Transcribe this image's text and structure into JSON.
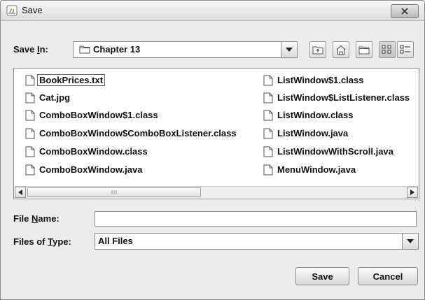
{
  "window": {
    "title": "Save"
  },
  "save_in": {
    "label_prefix": "Save ",
    "label_mnemonic": "I",
    "label_suffix": "n:",
    "selected": "Chapter 13"
  },
  "toolbar": {
    "buttons": [
      "up-one-level-icon",
      "home-icon",
      "new-folder-icon",
      "list-view-icon",
      "details-view-icon"
    ],
    "selected": "list-view-icon"
  },
  "files": {
    "column1": [
      "BookPrices.txt",
      "Cat.jpg",
      "ComboBoxWindow$1.class",
      "ComboBoxWindow$ComboBoxListener.class",
      "ComboBoxWindow.class",
      "ComboBoxWindow.java"
    ],
    "column2": [
      "ListWindow$1.class",
      "ListWindow$ListListener.class",
      "ListWindow.class",
      "ListWindow.java",
      "ListWindowWithScroll.java",
      "MenuWindow.java"
    ],
    "focused": "BookPrices.txt"
  },
  "file_name": {
    "label_prefix": "File ",
    "label_mnemonic": "N",
    "label_suffix": "ame:",
    "value": ""
  },
  "file_type": {
    "label_prefix": "Files of ",
    "label_mnemonic": "T",
    "label_suffix": "ype:",
    "selected": "All Files"
  },
  "buttons": {
    "save": "Save",
    "cancel": "Cancel"
  }
}
